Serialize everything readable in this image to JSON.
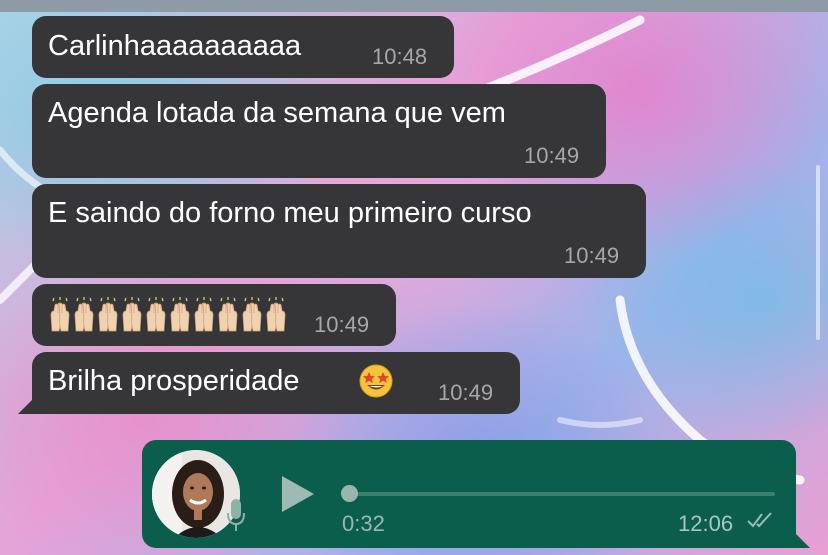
{
  "messages": [
    {
      "text": "Carlinhaaaaaaaaaa",
      "time": "10:48"
    },
    {
      "text": "Agenda lotada da semana que vem",
      "time": "10:49"
    },
    {
      "text": "E saindo do forno meu primeiro curso",
      "time": "10:49"
    },
    {
      "emoji_icons": [
        "raising-hands-icon",
        "raising-hands-icon",
        "raising-hands-icon",
        "raising-hands-icon",
        "raising-hands-icon",
        "raising-hands-icon",
        "raising-hands-icon",
        "raising-hands-icon",
        "raising-hands-icon",
        "raising-hands-icon"
      ],
      "time": "10:49"
    },
    {
      "text": "Brilha prosperidade",
      "emoji": "star-struck-icon",
      "time": "10:49"
    }
  ],
  "voice_message": {
    "duration": "0:32",
    "time": "12:06",
    "status_icon": "double-check-icon",
    "progress": 0.0
  },
  "colors": {
    "incoming_bubble": "#363638",
    "outgoing_bubble": "#0b5e4b",
    "timestamp": "#a7a7aa"
  }
}
